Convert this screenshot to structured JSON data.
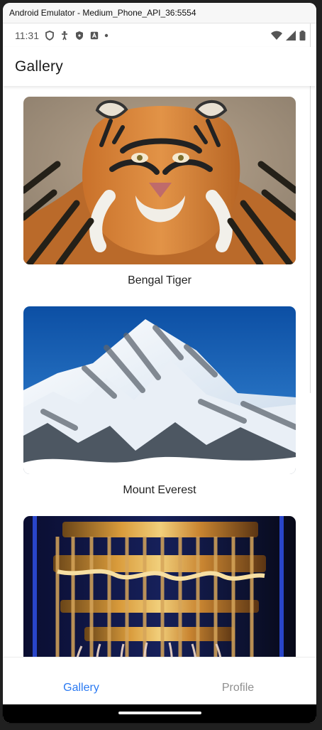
{
  "window": {
    "title": "Android Emulator - Medium_Phone_API_36:5554"
  },
  "status_bar": {
    "time": "11:31",
    "icons_left": [
      "shield-outline-icon",
      "accessibility-icon",
      "shield-icon",
      "text-icon",
      "dot-icon"
    ],
    "icons_right": [
      "wifi-icon",
      "signal-icon",
      "battery-icon"
    ]
  },
  "app_bar": {
    "title": "Gallery"
  },
  "gallery": {
    "items": [
      {
        "caption": "Bengal Tiger",
        "image": "tiger-photo"
      },
      {
        "caption": "Mount Everest",
        "image": "mountain-photo"
      },
      {
        "caption": "",
        "image": "quantum-computer-photo"
      }
    ]
  },
  "bottom_nav": {
    "items": [
      {
        "label": "Gallery",
        "active": true
      },
      {
        "label": "Profile",
        "active": false
      }
    ],
    "active_color": "#2979f2",
    "inactive_color": "#8f8f8f"
  }
}
